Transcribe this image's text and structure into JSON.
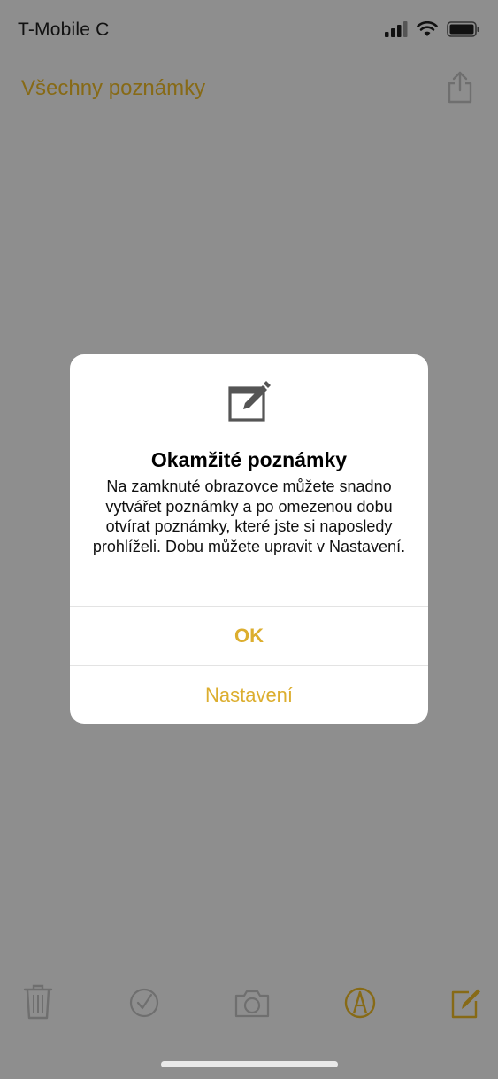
{
  "status_bar": {
    "carrier": "T-Mobile C",
    "icons": [
      "signal-icon",
      "wifi-icon",
      "battery-icon"
    ]
  },
  "nav": {
    "title": "Všechny poznámky",
    "share_icon": "share-icon"
  },
  "dialog": {
    "icon": "compose-note-icon",
    "title": "Okamžité poznámky",
    "message": "Na zamknuté obrazovce můžete snadno vytvářet poznámky a po omezenou dobu otvírat poznámky, které jste si naposledy prohlíželi. Dobu můžete upravit v Nastavení.",
    "buttons": {
      "ok": "OK",
      "settings": "Nastavení"
    }
  },
  "toolbar": {
    "icons": [
      "trash-icon",
      "checklist-icon",
      "camera-icon",
      "markup-icon",
      "compose-icon"
    ]
  },
  "colors": {
    "accent": "#dcae2f",
    "accent_dimmed": "#876a16",
    "backdrop": "#8e8e8e"
  }
}
